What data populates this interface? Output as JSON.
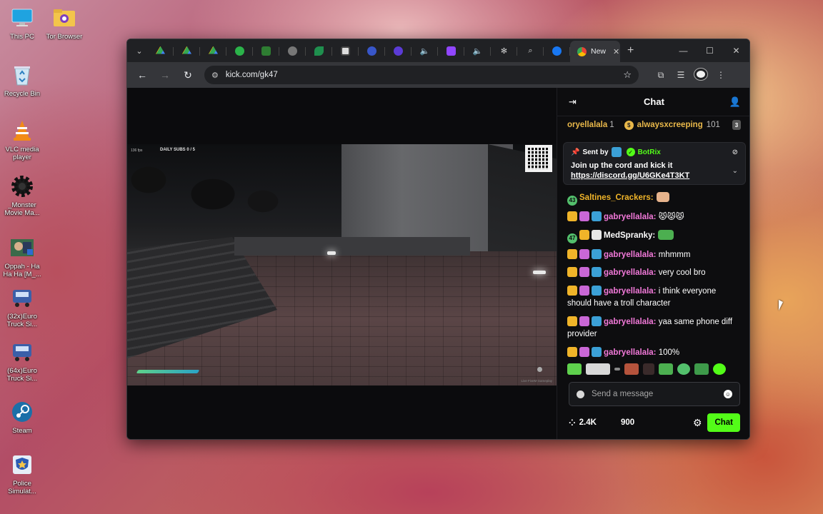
{
  "desktop": {
    "icons": [
      {
        "label": "This PC",
        "icon": "monitor-icon"
      },
      {
        "label": "Tor Browser",
        "icon": "folder-tor-icon"
      },
      {
        "label": "Recycle Bin",
        "icon": "recycle-bin-icon"
      },
      {
        "label": "VLC media player",
        "icon": "vlc-cone-icon"
      },
      {
        "label": "_Monster Movie Ma...",
        "icon": "gear-icon"
      },
      {
        "label": "Oppah - Ha Ha Ha [M_...",
        "icon": "video-thumbnail-icon"
      },
      {
        "label": "(32x)Euro Truck Si...",
        "icon": "truck-icon"
      },
      {
        "label": "(64x)Euro Truck Si...",
        "icon": "truck-icon"
      },
      {
        "label": "Steam",
        "icon": "steam-icon"
      },
      {
        "label": "Police Simulat...",
        "icon": "police-shield-icon"
      }
    ]
  },
  "browser": {
    "active_tab_title": "New",
    "url": "kick.com/gk47",
    "colors": {
      "kick_green": "#53fc18",
      "chrome_dark": "#202124",
      "toolbar": "#35363a"
    }
  },
  "video": {
    "hud_top": "DAILY SUBS 0 / 5",
    "hud_corner": "136 fps",
    "watermark": "Live FiveM Gameplay"
  },
  "chat": {
    "title": "Chat",
    "top_gifters": [
      {
        "name": "oryellalala",
        "count": "1"
      },
      {
        "name": "alwaysxcreeping",
        "count": "101",
        "rank": "3"
      }
    ],
    "pinned": {
      "sent_by_label": "Sent by",
      "sender": "BotRix",
      "message": "Join up the cord and kick it",
      "link": "https://discord.gg/U6GKe4T3KT"
    },
    "messages": [
      {
        "user": "Saltines_Crackers:",
        "text": "",
        "user_color": "#f0b429",
        "level": "43"
      },
      {
        "user": "gabryellalala:",
        "text": "😾😾😾",
        "user_color": "#f279d9"
      },
      {
        "user": "MedSpranky:",
        "text": "",
        "user_color": "#ffffff",
        "level": "47"
      },
      {
        "user": "gabryellalala:",
        "text": " mhmmm",
        "user_color": "#f279d9"
      },
      {
        "user": "gabryellalala:",
        "text": " very cool bro",
        "user_color": "#f279d9"
      },
      {
        "user": "gabryellalala:",
        "text": " i think everyone should have a troll character",
        "user_color": "#f279d9"
      },
      {
        "user": "gabryellalala:",
        "text": " yaa same phone diff provider",
        "user_color": "#f279d9"
      },
      {
        "user": "gabryellalala:",
        "text": " 100%",
        "user_color": "#f279d9"
      }
    ],
    "input_placeholder": "Send a message",
    "viewers": "2.4K",
    "points": "900",
    "send_label": "Chat"
  }
}
